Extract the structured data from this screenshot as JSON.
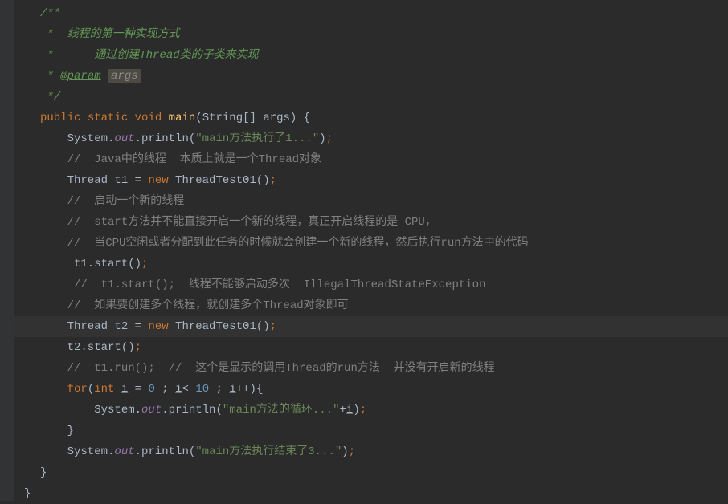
{
  "doc": {
    "l1": "/**",
    "l2": " *  线程的第一种实现方式",
    "l3": " *      通过创建Thread类的子类来实现",
    "l4_star": " * ",
    "l4_tag": "@param",
    "l4_arg": "args",
    "l5": " */"
  },
  "sig": {
    "public": "public",
    "static": "static",
    "void": "void",
    "main": "main",
    "paren_open": "(",
    "string_arr": "String[] ",
    "args": "args",
    "paren_close_brace": ") {"
  },
  "lines": {
    "l7_pre": "    System.",
    "l7_out": "out",
    "l7_println": ".println(",
    "l7_str": "\"main方法执行了1...\"",
    "l7_close": ")",
    "l7_semi": ";",
    "l8": "    //  Java中的线程  本质上就是一个Thread对象",
    "l9_pre": "    Thread t1 = ",
    "l9_new": "new",
    "l9_class": " ThreadTest01()",
    "l9_semi": ";",
    "l10": "    //  启动一个新的线程",
    "l11": "    //  start方法并不能直接开启一个新的线程，真正开启线程的是 CPU，",
    "l12": "    //  当CPU空闲或者分配到此任务的时候就会创建一个新的线程，然后执行run方法中的代码",
    "l13_pre": "     t1.start()",
    "l13_semi": ";",
    "l14": "     //  t1.start();  线程不能够启动多次  IllegalThreadStateException",
    "l15": "    //  如果要创建多个线程，就创建多个Thread对象即可",
    "l16_pre": "    Thread t2 = ",
    "l16_new": "new",
    "l16_class": " ThreadTest01()",
    "l16_semi": ";",
    "l17_pre": "    t2.start()",
    "l17_semi": ";",
    "l18": "    //  t1.run();  //  这个是显示的调用Thread的run方法  并没有开启新的线程",
    "l19_for": "    for",
    "l19_open": "(",
    "l19_int": "int",
    "l19_sp1": " ",
    "l19_i1": "i",
    "l19_eq": " = ",
    "l19_zero": "0",
    "l19_sc1": " ; ",
    "l19_i2": "i",
    "l19_lt": "< ",
    "l19_ten": "10",
    "l19_sc2": " ; ",
    "l19_i3": "i",
    "l19_inc": "++){",
    "l20_pre": "        System.",
    "l20_out": "out",
    "l20_println": ".println(",
    "l20_str": "\"main方法的循环...\"",
    "l20_plus": "+",
    "l20_i": "i",
    "l20_close": ")",
    "l20_semi": ";",
    "l21": "    }",
    "l22_pre": "    System.",
    "l22_out": "out",
    "l22_println": ".println(",
    "l22_str": "\"main方法执行结束了3...\"",
    "l22_close": ")",
    "l22_semi": ";",
    "l23": "}",
    "l24": "}"
  }
}
